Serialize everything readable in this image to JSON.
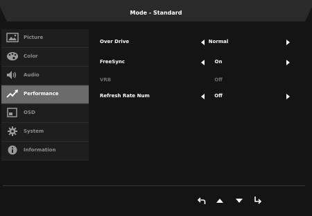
{
  "title": "Mode - Standard",
  "sidebar": {
    "items": [
      {
        "label": "Picture",
        "icon": "picture-icon"
      },
      {
        "label": "Color",
        "icon": "palette-icon"
      },
      {
        "label": "Audio",
        "icon": "speaker-icon"
      },
      {
        "label": "Performance",
        "icon": "performance-icon",
        "active": true
      },
      {
        "label": "OSD",
        "icon": "osd-icon"
      },
      {
        "label": "System",
        "icon": "gear-icon"
      },
      {
        "label": "Information",
        "icon": "info-icon"
      }
    ]
  },
  "settings": [
    {
      "label": "Over Drive",
      "value": "Normal",
      "enabled": true
    },
    {
      "label": "FreeSync",
      "value": "On",
      "enabled": true
    },
    {
      "label": "VRB",
      "value": "Off",
      "enabled": false
    },
    {
      "label": "Refresh Rate Num",
      "value": "Off",
      "enabled": true
    }
  ],
  "footer": {
    "buttons": [
      "back-icon",
      "up-arrow-icon",
      "down-arrow-icon",
      "enter-icon"
    ]
  },
  "colors": {
    "background": "#141414",
    "active_item": "#6b6b6b",
    "text": "#ffffff",
    "muted_text": "#8c8c8c"
  }
}
